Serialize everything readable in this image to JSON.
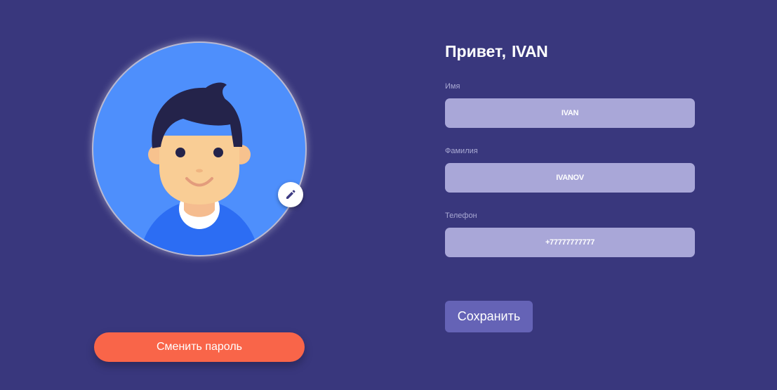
{
  "profile": {
    "greeting_prefix": "Привет,",
    "greeting_name": "IVAN",
    "change_password_label": "Сменить пароль",
    "save_label": "Сохранить"
  },
  "fields": {
    "first_name": {
      "label": "Имя",
      "value": "IVAN"
    },
    "last_name": {
      "label": "Фамилия",
      "value": "IVANOV"
    },
    "phone": {
      "label": "Телефон",
      "value": "+77777777777"
    }
  },
  "icons": {
    "edit": "pencil-icon",
    "avatar": "user-avatar-icon"
  },
  "colors": {
    "background": "#39377d",
    "avatar_bg": "#4e8ffc",
    "input_bg": "#a9a7d8",
    "change_password_button": "#f96549",
    "save_button": "#6563b6"
  }
}
